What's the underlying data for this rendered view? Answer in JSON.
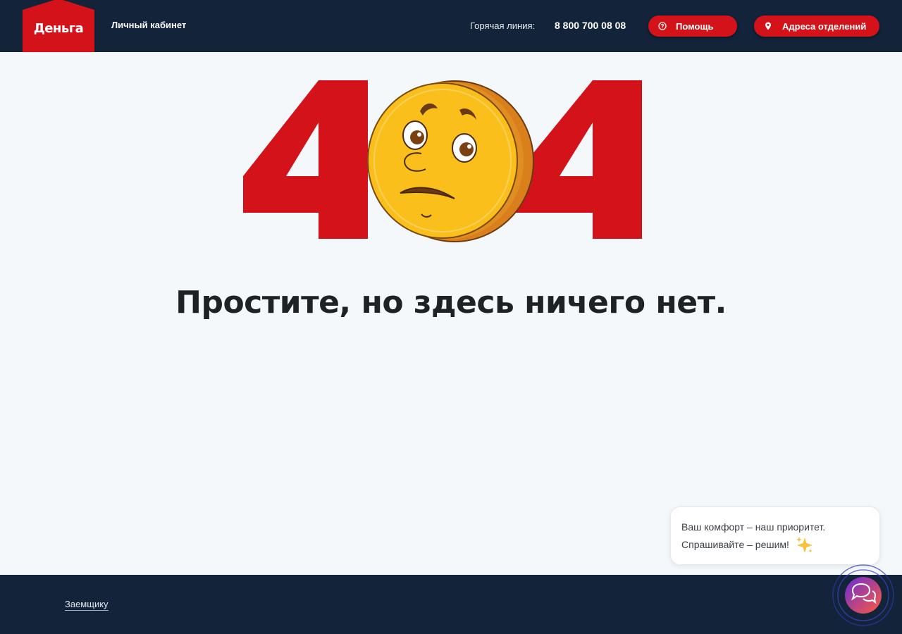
{
  "header": {
    "logo_text": "Деньга",
    "cabinet_link": "Личный кабинет",
    "hotline_label": "Горячая линия:",
    "hotline_phone": "8 800 700 08 08",
    "help_button": "Помощь",
    "branches_button": "Адреса отделений"
  },
  "main": {
    "error_code": "404",
    "headline": "Простите, но здесь ничего нет."
  },
  "chat": {
    "message_line1": "Ваш комфорт – наш приоритет.",
    "message_line2": "Спрашивайте – решим!",
    "sparkle_icon": "sparkles-icon",
    "launcher_icon": "chat-bubbles-icon"
  },
  "footer": {
    "borrower_link": "Заемщику"
  },
  "colors": {
    "header_bg": "#12233a",
    "brand_red": "#d3121a",
    "coin_yellow": "#fbbf1b",
    "page_bg": "#f5f8fb"
  }
}
